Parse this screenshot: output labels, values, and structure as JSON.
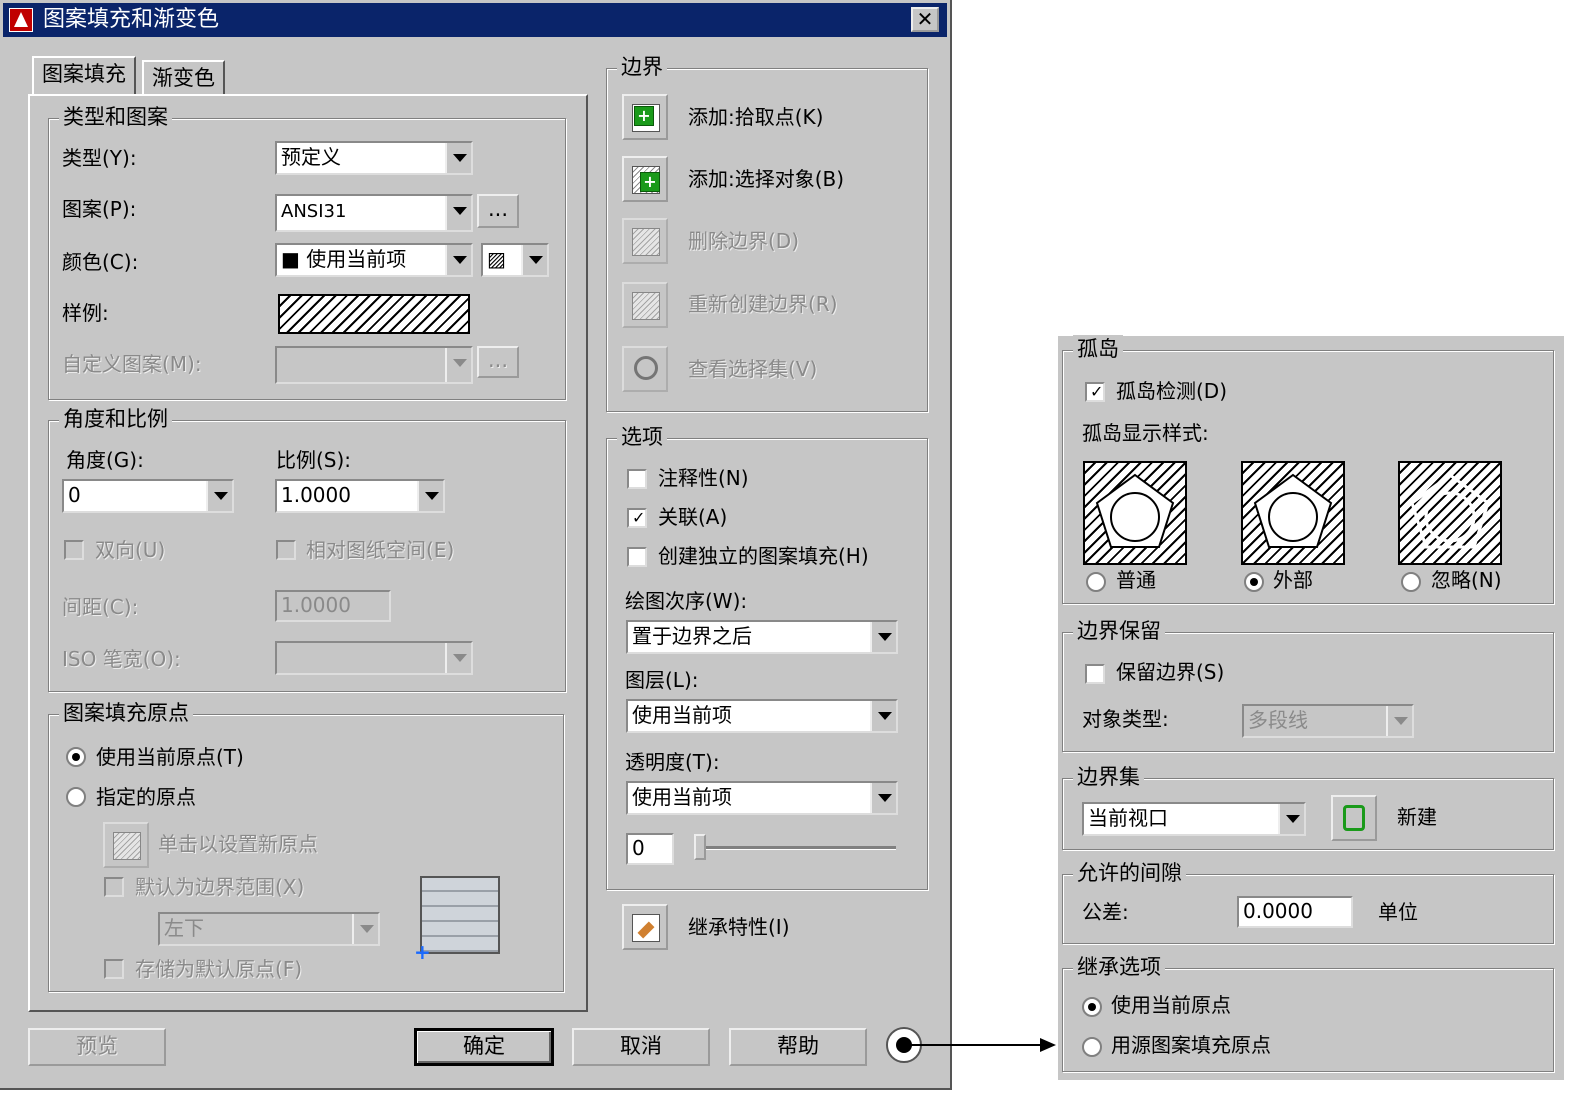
{
  "window": {
    "title": "图案填充和渐变色",
    "close_label": "✕"
  },
  "tabs": [
    {
      "label": "图案填充"
    },
    {
      "label": "渐变色"
    }
  ],
  "type_pattern": {
    "legend": "类型和图案",
    "type_label": "类型(Y):",
    "type_value": "预定义",
    "pattern_label": "图案(P):",
    "pattern_value": "ANSI31",
    "pattern_browse": "...",
    "color_label": "颜色(C):",
    "color_value": "■ 使用当前项",
    "color_bg_value": "▨",
    "sample_label": "样例:",
    "custom_label": "自定义图案(M):",
    "custom_browse": "..."
  },
  "angle_scale": {
    "legend": "角度和比例",
    "angle_label": "角度(G):",
    "angle_value": "0",
    "scale_label": "比例(S):",
    "scale_value": "1.0000",
    "double_label": "双向(U)",
    "relative_label": "相对图纸空间(E)",
    "spacing_label": "间距(C):",
    "spacing_value": "1.0000",
    "iso_label": "ISO 笔宽(O):"
  },
  "origin": {
    "legend": "图案填充原点",
    "use_current_label": "使用当前原点(T)",
    "specified_label": "指定的原点",
    "click_set_label": "单击以设置新原点",
    "default_extents_label": "默认为边界范围(X)",
    "position_value": "左下",
    "store_default_label": "存储为默认原点(F)"
  },
  "boundary": {
    "legend": "边界",
    "add_pick_label": "添加:拾取点(K)",
    "add_select_label": "添加:选择对象(B)",
    "remove_label": "删除边界(D)",
    "recreate_label": "重新创建边界(R)",
    "view_label": "查看选择集(V)"
  },
  "options": {
    "legend": "选项",
    "annotative_label": "注释性(N)",
    "associative_label": "关联(A)",
    "separate_label": "创建独立的图案填充(H)",
    "draw_order_label": "绘图次序(W):",
    "draw_order_value": "置于边界之后",
    "layer_label": "图层(L):",
    "layer_value": "使用当前项",
    "transparency_label": "透明度(T):",
    "transparency_value": "使用当前项",
    "transparency_number": "0"
  },
  "inherit": {
    "label": "继承特性(I)"
  },
  "buttons": {
    "preview": "预览",
    "ok": "确定",
    "cancel": "取消",
    "help": "帮助"
  },
  "more": {
    "islands": {
      "legend": "孤岛",
      "detect_label": "孤岛检测(D)",
      "style_label": "孤岛显示样式:",
      "normal_label": "普通",
      "outer_label": "外部",
      "ignore_label": "忽略(N)"
    },
    "retain": {
      "legend": "边界保留",
      "retain_label": "保留边界(S)",
      "object_type_label": "对象类型:",
      "object_type_value": "多段线"
    },
    "boundary_set": {
      "legend": "边界集",
      "value": "当前视口",
      "new_label": "新建"
    },
    "gap": {
      "legend": "允许的间隙",
      "tolerance_label": "公差:",
      "tolerance_value": "0.0000",
      "unit_label": "单位"
    },
    "inherit_options": {
      "legend": "继承选项",
      "current_origin_label": "使用当前原点",
      "source_origin_label": "用源图案填充原点"
    }
  }
}
